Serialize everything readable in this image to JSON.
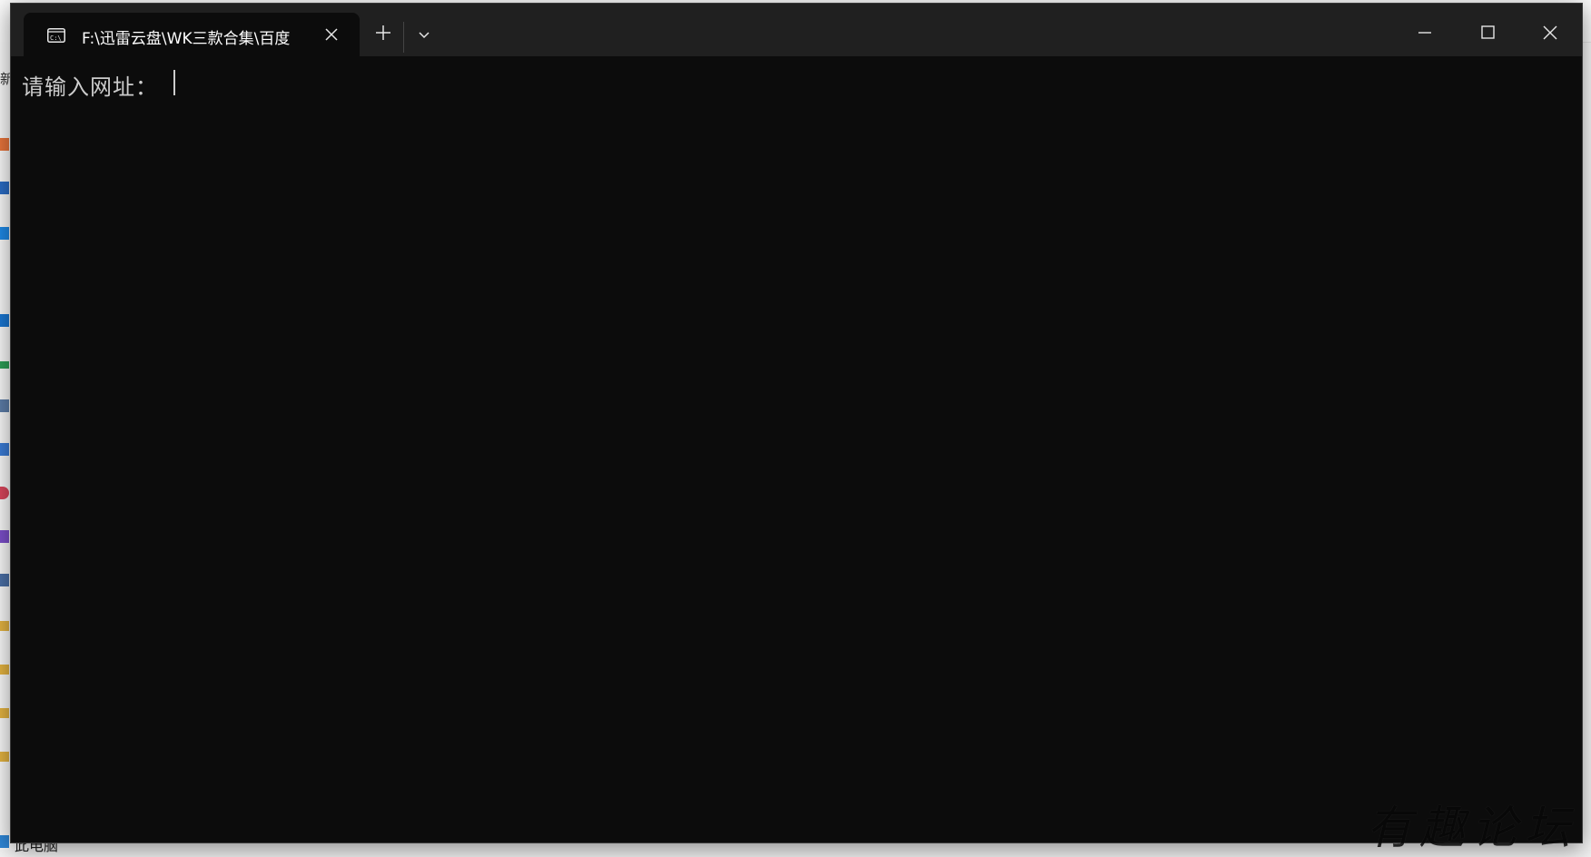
{
  "background": {
    "sidebar_fragment_label": "新",
    "this_pc_label": "此电脑"
  },
  "terminal": {
    "tab": {
      "title": "F:\\迅雷云盘\\WK三款合集\\百度",
      "icon": "cmd-icon"
    },
    "new_tab_icon": "plus-icon",
    "dropdown_icon": "chevron-down-icon",
    "window_controls": {
      "minimize_icon": "minimize-icon",
      "maximize_icon": "maximize-icon",
      "close_icon": "close-icon"
    },
    "prompt": "请输入网址："
  },
  "watermark": "有趣论坛",
  "colors": {
    "terminal_bg": "#0c0c0c",
    "titlebar_bg": "#202020",
    "text": "#cccccc"
  }
}
